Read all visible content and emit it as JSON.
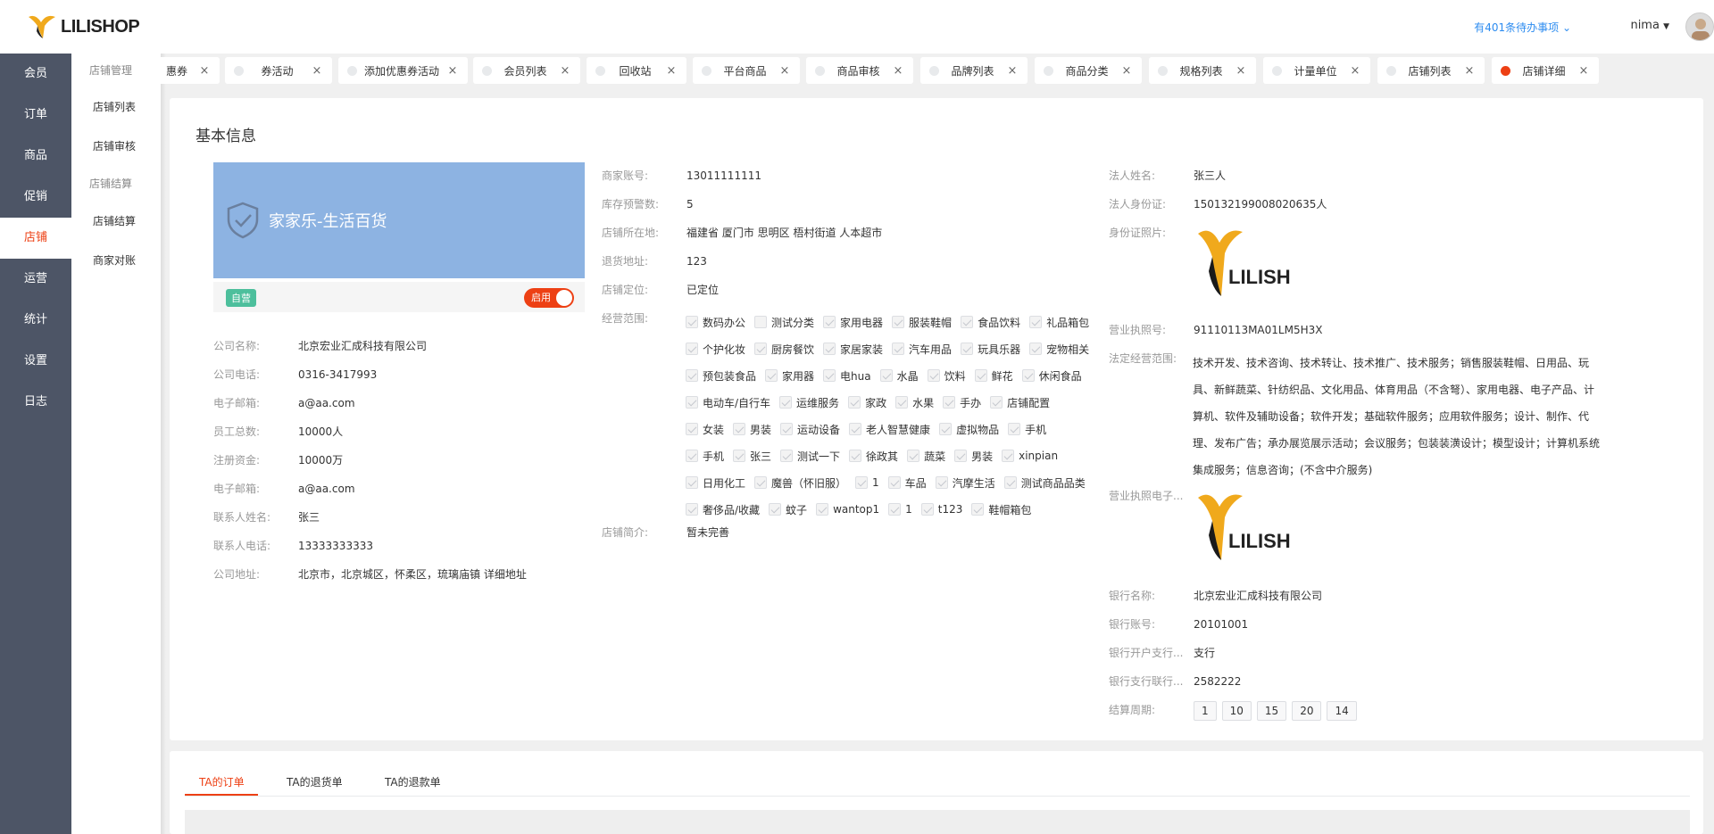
{
  "app": {
    "logo_text": "LILISHOP"
  },
  "nav": {
    "items": [
      {
        "label": "会员"
      },
      {
        "label": "订单"
      },
      {
        "label": "商品"
      },
      {
        "label": "促销"
      },
      {
        "label": "店铺"
      },
      {
        "label": "运营"
      },
      {
        "label": "统计"
      },
      {
        "label": "设置"
      },
      {
        "label": "日志"
      }
    ],
    "active": "店铺"
  },
  "subnav": {
    "group1": "店铺管理",
    "item1": "店铺列表",
    "item2": "店铺审核",
    "group2": "店铺结算",
    "item3": "店铺结算",
    "item4": "商家对账"
  },
  "header": {
    "todo": "有401条待办事项",
    "user": "nima"
  },
  "tabs": [
    {
      "label": "惠券"
    },
    {
      "label": "券活动"
    },
    {
      "label": "添加优惠券活动"
    },
    {
      "label": "会员列表"
    },
    {
      "label": "回收站"
    },
    {
      "label": "平台商品"
    },
    {
      "label": "商品审核"
    },
    {
      "label": "品牌列表"
    },
    {
      "label": "商品分类"
    },
    {
      "label": "规格列表"
    },
    {
      "label": "计量单位"
    },
    {
      "label": "店铺列表"
    },
    {
      "label": "店铺详细"
    }
  ],
  "basic": {
    "title": "基本信息",
    "store_name": "家家乐-生活百货",
    "self_tag": "自营",
    "switch_label": "启用",
    "company": [
      {
        "label": "公司名称:",
        "value": "北京宏业汇成科技有限公司"
      },
      {
        "label": "公司电话:",
        "value": "0316-3417993"
      },
      {
        "label": "电子邮箱:",
        "value": "a@aa.com"
      },
      {
        "label": "员工总数:",
        "value": "10000人"
      },
      {
        "label": "注册资金:",
        "value": "10000万"
      },
      {
        "label": "电子邮箱:",
        "value": "a@aa.com"
      },
      {
        "label": "联系人姓名:",
        "value": "张三"
      },
      {
        "label": "联系人电话:",
        "value": "13333333333"
      },
      {
        "label": "公司地址:",
        "value": "北京市，北京城区，怀柔区，琉璃庙镇 详细地址"
      }
    ],
    "merchant": [
      {
        "label": "商家账号:",
        "value": "13011111111"
      },
      {
        "label": "库存预警数:",
        "value": "5"
      },
      {
        "label": "店铺所在地:",
        "value": "福建省 厦门市 思明区 梧村街道 人本超市"
      },
      {
        "label": "退货地址:",
        "value": "123"
      },
      {
        "label": "店铺定位:",
        "value": "已定位"
      }
    ],
    "scope_label": "经营范围:",
    "scope_lines": [
      [
        {
          "t": "数码办公",
          "c": true
        },
        {
          "t": "测试分类",
          "c": false
        },
        {
          "t": "家用电器",
          "c": true
        },
        {
          "t": "服装鞋帽",
          "c": true
        },
        {
          "t": "食品饮料",
          "c": true
        },
        {
          "t": "礼品箱包",
          "c": true
        }
      ],
      [
        {
          "t": "个护化妆",
          "c": true
        },
        {
          "t": "厨房餐饮",
          "c": true
        },
        {
          "t": "家居家装",
          "c": true
        },
        {
          "t": "汽车用品",
          "c": true
        },
        {
          "t": "玩具乐器",
          "c": true
        },
        {
          "t": "宠物相关",
          "c": true
        }
      ],
      [
        {
          "t": "预包装食品",
          "c": true
        },
        {
          "t": "家用器",
          "c": true
        },
        {
          "t": "电hua",
          "c": true
        },
        {
          "t": "水晶",
          "c": true
        },
        {
          "t": "饮料",
          "c": true
        },
        {
          "t": "鲜花",
          "c": true
        },
        {
          "t": "休闲食品",
          "c": true
        }
      ],
      [
        {
          "t": "电动车/自行车",
          "c": true
        },
        {
          "t": "运维服务",
          "c": true
        },
        {
          "t": "家政",
          "c": true
        },
        {
          "t": "水果",
          "c": true
        },
        {
          "t": "手办",
          "c": true
        },
        {
          "t": "店铺配置",
          "c": true
        }
      ],
      [
        {
          "t": "女装",
          "c": true
        },
        {
          "t": "男装",
          "c": true
        },
        {
          "t": "运动设备",
          "c": true
        },
        {
          "t": "老人智慧健康",
          "c": true
        },
        {
          "t": "虚拟物品",
          "c": true
        },
        {
          "t": "手机",
          "c": true
        }
      ],
      [
        {
          "t": "手机",
          "c": true
        },
        {
          "t": "张三",
          "c": true
        },
        {
          "t": "测试一下",
          "c": true
        },
        {
          "t": "徐政其",
          "c": true
        },
        {
          "t": "蔬菜",
          "c": true
        },
        {
          "t": "男装",
          "c": true
        },
        {
          "t": "xinpian",
          "c": true
        }
      ],
      [
        {
          "t": "日用化工",
          "c": true
        },
        {
          "t": "魔兽（怀旧服）",
          "c": true
        },
        {
          "t": "1",
          "c": true
        },
        {
          "t": "车品",
          "c": true
        },
        {
          "t": "汽摩生活",
          "c": true
        },
        {
          "t": "测试商品品类",
          "c": true
        }
      ],
      [
        {
          "t": "奢侈品/收藏",
          "c": true
        },
        {
          "t": "蚊子",
          "c": true
        },
        {
          "t": "wantop1",
          "c": true
        },
        {
          "t": "1",
          "c": true
        },
        {
          "t": "t123",
          "c": true
        },
        {
          "t": "鞋帽箱包",
          "c": true
        }
      ]
    ],
    "intro_label": "店铺简介:",
    "intro_value": "暂未完善",
    "legal": [
      {
        "label": "法人姓名:",
        "value": "张三人"
      },
      {
        "label": "法人身份证:",
        "value": "150132199008020635人"
      }
    ],
    "id_photo_label": "身份证照片:",
    "license_no_label": "营业执照号:",
    "license_no_value": "91110113MA01LM5H3X",
    "biz_scope_label": "法定经营范围:",
    "biz_scope_value": "技术开发、技术咨询、技术转让、技术推广、技术服务；销售服装鞋帽、日用品、玩具、新鲜蔬菜、针纺织品、文化用品、体育用品（不含弩）、家用电器、电子产品、计算机、软件及辅助设备；软件开发；基础软件服务；应用软件服务；设计、制作、代理、发布广告；承办展览展示活动；会议服务；包装装潢设计；模型设计；计算机系统集成服务；信息咨询；(不含中介服务)",
    "license_img_label": "营业执照电子...",
    "bank": [
      {
        "label": "银行名称:",
        "value": "北京宏业汇成科技有限公司"
      },
      {
        "label": "银行账号:",
        "value": "20101001"
      },
      {
        "label": "银行开户支行...",
        "value": "支行"
      },
      {
        "label": "银行支行联行...",
        "value": "2582222"
      }
    ],
    "period_label": "结算周期:",
    "periods": [
      "1",
      "10",
      "15",
      "20",
      "14"
    ]
  },
  "bottom_tabs": [
    {
      "label": "TA的订单"
    },
    {
      "label": "TA的退货单"
    },
    {
      "label": "TA的退款单"
    }
  ],
  "colors": {
    "accent": "#ed4014",
    "sidebar": "#4d5566",
    "store_box": "#8db3e2",
    "link": "#2d8cf0"
  }
}
